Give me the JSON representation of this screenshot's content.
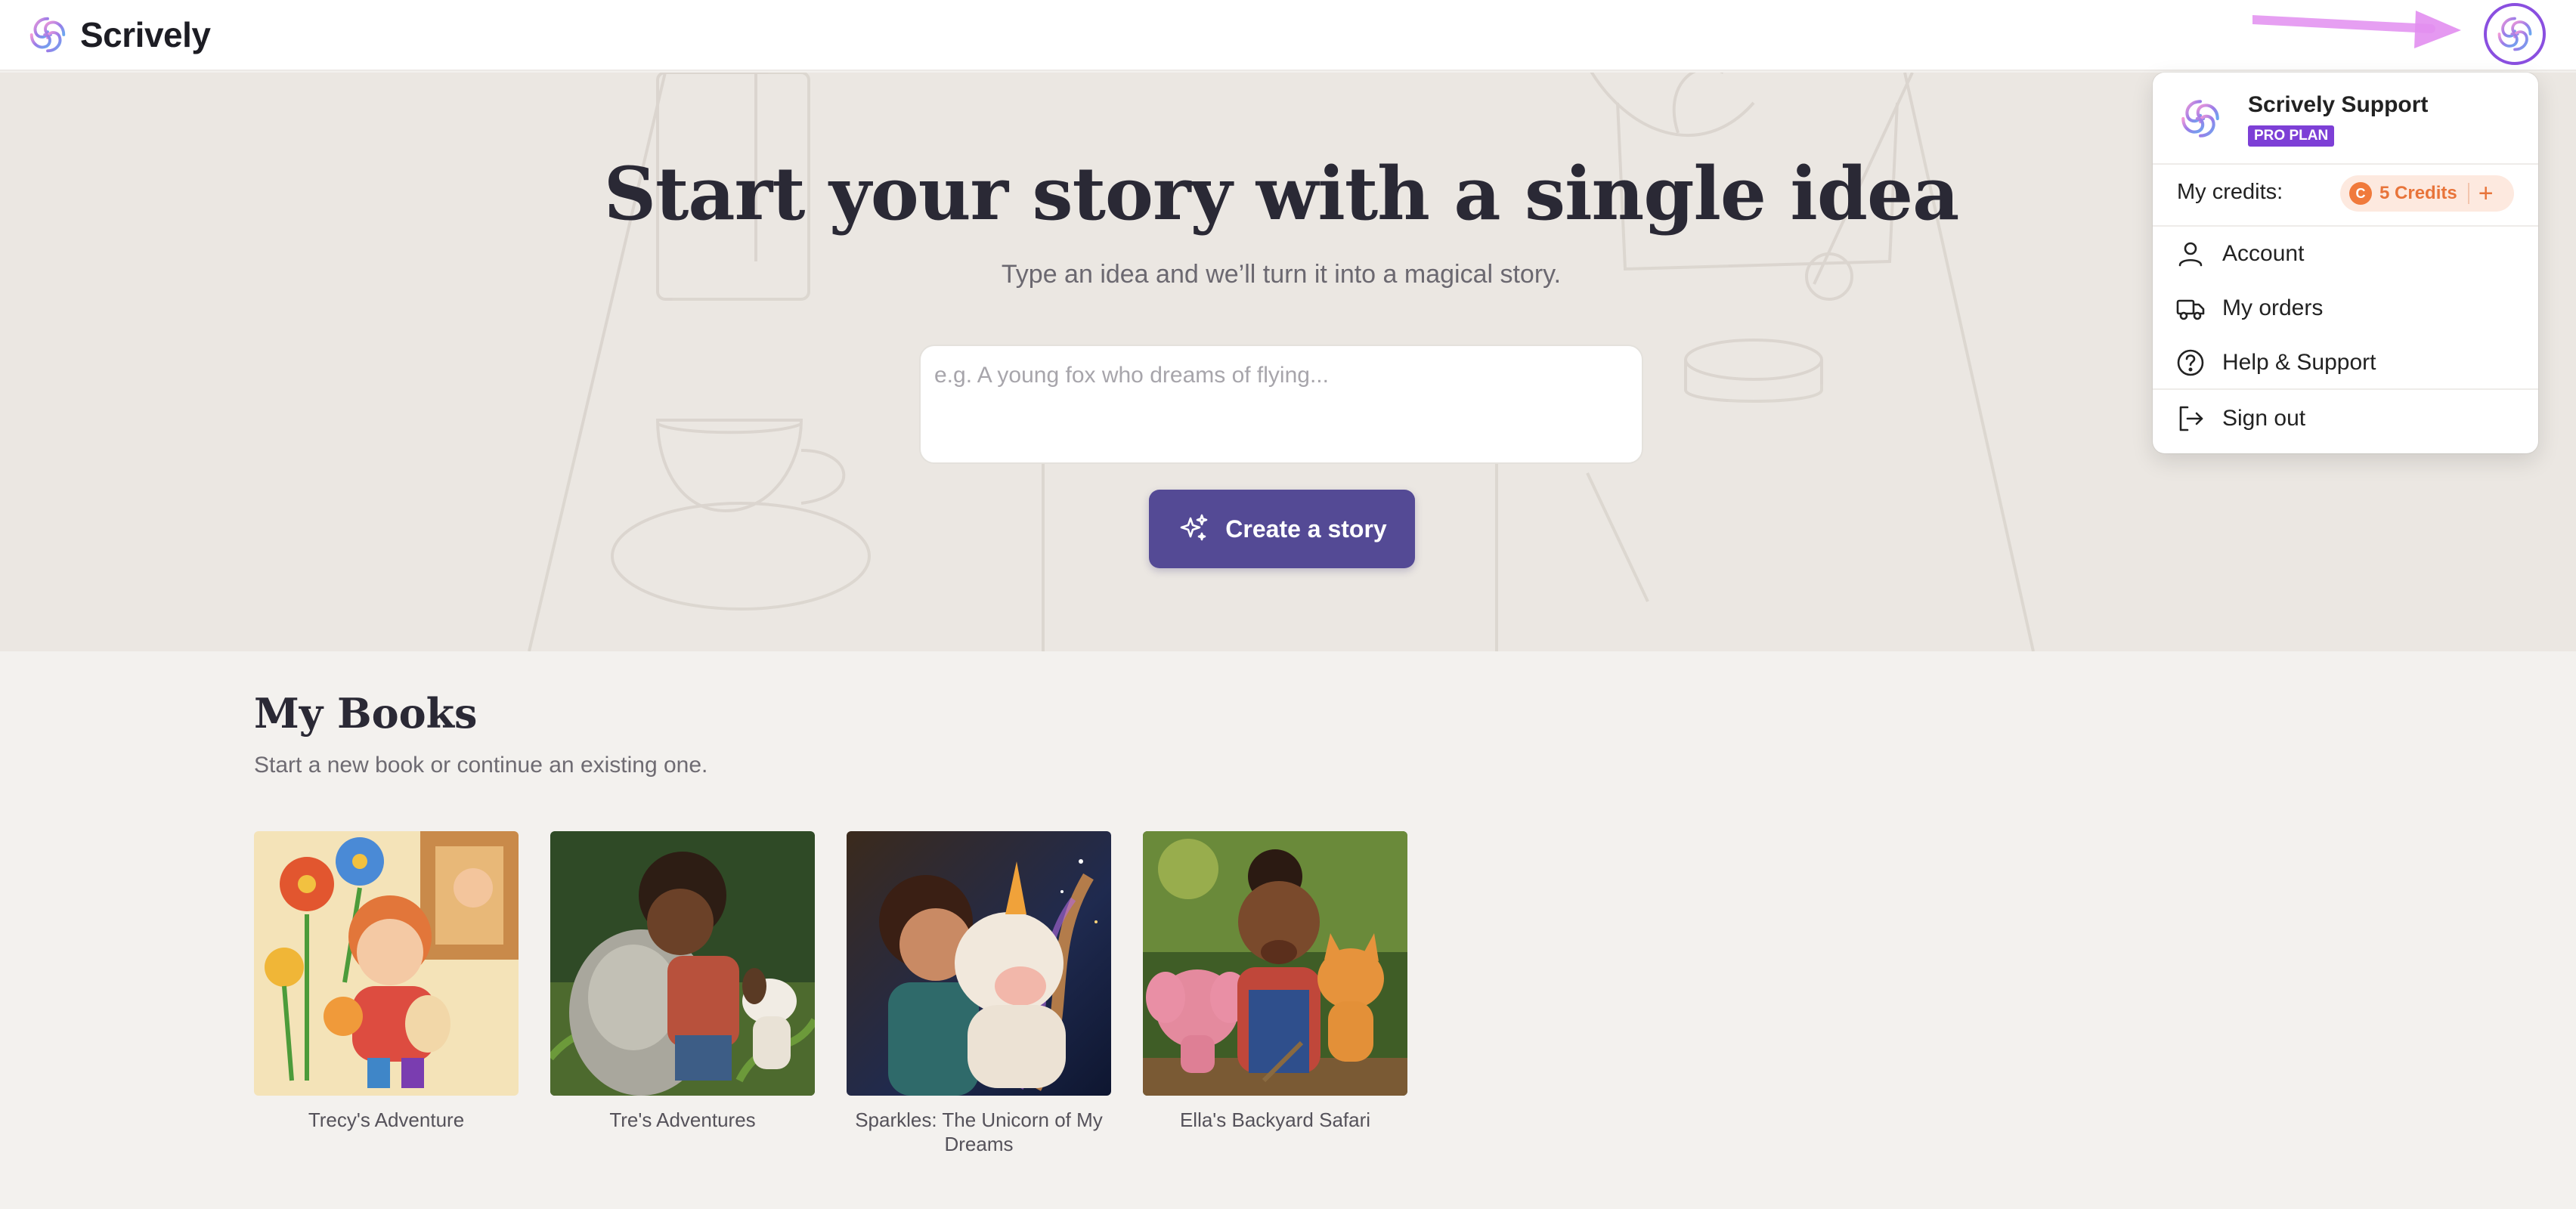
{
  "app": {
    "name": "Scrively",
    "brand_color": "#8a4fe0",
    "logo_icon": "swirl-logo-icon"
  },
  "header": {
    "avatar_icon": "swirl-logo-icon"
  },
  "hero": {
    "title": "Start your story with a single idea",
    "subtitle": "Type an idea and we’ll turn it into a magical story.",
    "idea_input": {
      "value": "",
      "placeholder": "e.g. A young fox who dreams of flying..."
    },
    "create_button": {
      "label": "Create a story",
      "icon": "sparkles-icon",
      "color": "#544a95"
    }
  },
  "books": {
    "title": "My Books",
    "subtitle": "Start a new book or continue an existing one.",
    "items": [
      {
        "title": "Trecy's Adventure"
      },
      {
        "title": "Tre's Adventures"
      },
      {
        "title": "Sparkles: The Unicorn of My Dreams"
      },
      {
        "title": "Ella's Backyard Safari"
      }
    ]
  },
  "user_menu": {
    "user_name": "Scrively Support",
    "plan_badge": "PRO PLAN",
    "plan_color": "#7d3fd6",
    "credits_label": "My credits:",
    "credits_value": "5 Credits",
    "credits_coin": "C",
    "credits_add": "+",
    "credits_color": "#e8743a",
    "items": [
      {
        "label": "Account",
        "icon": "user-icon"
      },
      {
        "label": "My orders",
        "icon": "truck-icon"
      },
      {
        "label": "Help & Support",
        "icon": "help-circle-icon"
      },
      {
        "label": "Sign out",
        "icon": "sign-out-icon"
      }
    ]
  }
}
